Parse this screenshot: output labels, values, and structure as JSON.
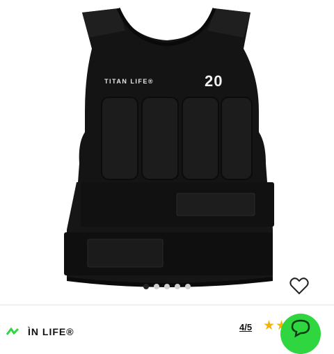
{
  "product": {
    "vest_brand_print": "TITAN LIFE®",
    "vest_size_print": "20"
  },
  "gallery": {
    "image_count": 5,
    "active_index": 0
  },
  "favorite": {
    "icon": "heart-outline-icon"
  },
  "footer": {
    "brand": "ÌN LIFE®",
    "rating": "4/5",
    "stars_filled": 2,
    "stars_total": 5,
    "chat_icon": "chat-bubble-icon",
    "chat_color": "#2fd63f",
    "star_color": "#f4b400"
  }
}
